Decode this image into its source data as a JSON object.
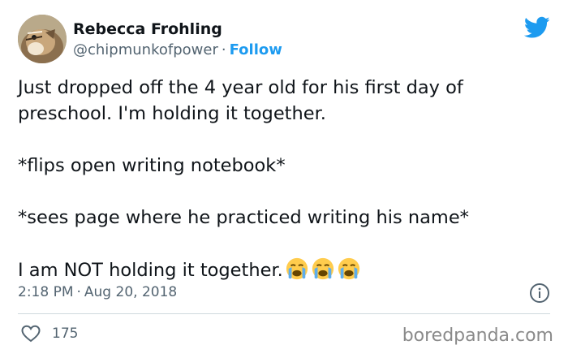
{
  "colors": {
    "accent": "#1d9bf0",
    "text_primary": "#0f1419",
    "text_secondary": "#536471",
    "divider": "#cfd9de"
  },
  "author": {
    "display_name": "Rebecca Frohling",
    "handle": "@chipmunkofpower",
    "separator": "·",
    "follow_label": "Follow",
    "avatar_icon": "chipmunk-avatar"
  },
  "brand_icon": "twitter-bird-icon",
  "tweet": {
    "line1": "Just dropped off the 4 year old for his first day of preschool. I'm holding it together.",
    "line2": "*flips open writing notebook*",
    "line3": "*sees page where he practiced writing his name*",
    "line4": "I am NOT holding it together.",
    "emoji_icon": "loudly-crying-face-emoji",
    "emoji_count": 3
  },
  "meta": {
    "time": "2:18 PM",
    "separator": "·",
    "date": "Aug 20, 2018",
    "info_icon": "info-icon"
  },
  "engagement": {
    "like_icon": "heart-icon",
    "like_count": "175"
  },
  "watermark": {
    "text": "boredpanda.com"
  }
}
